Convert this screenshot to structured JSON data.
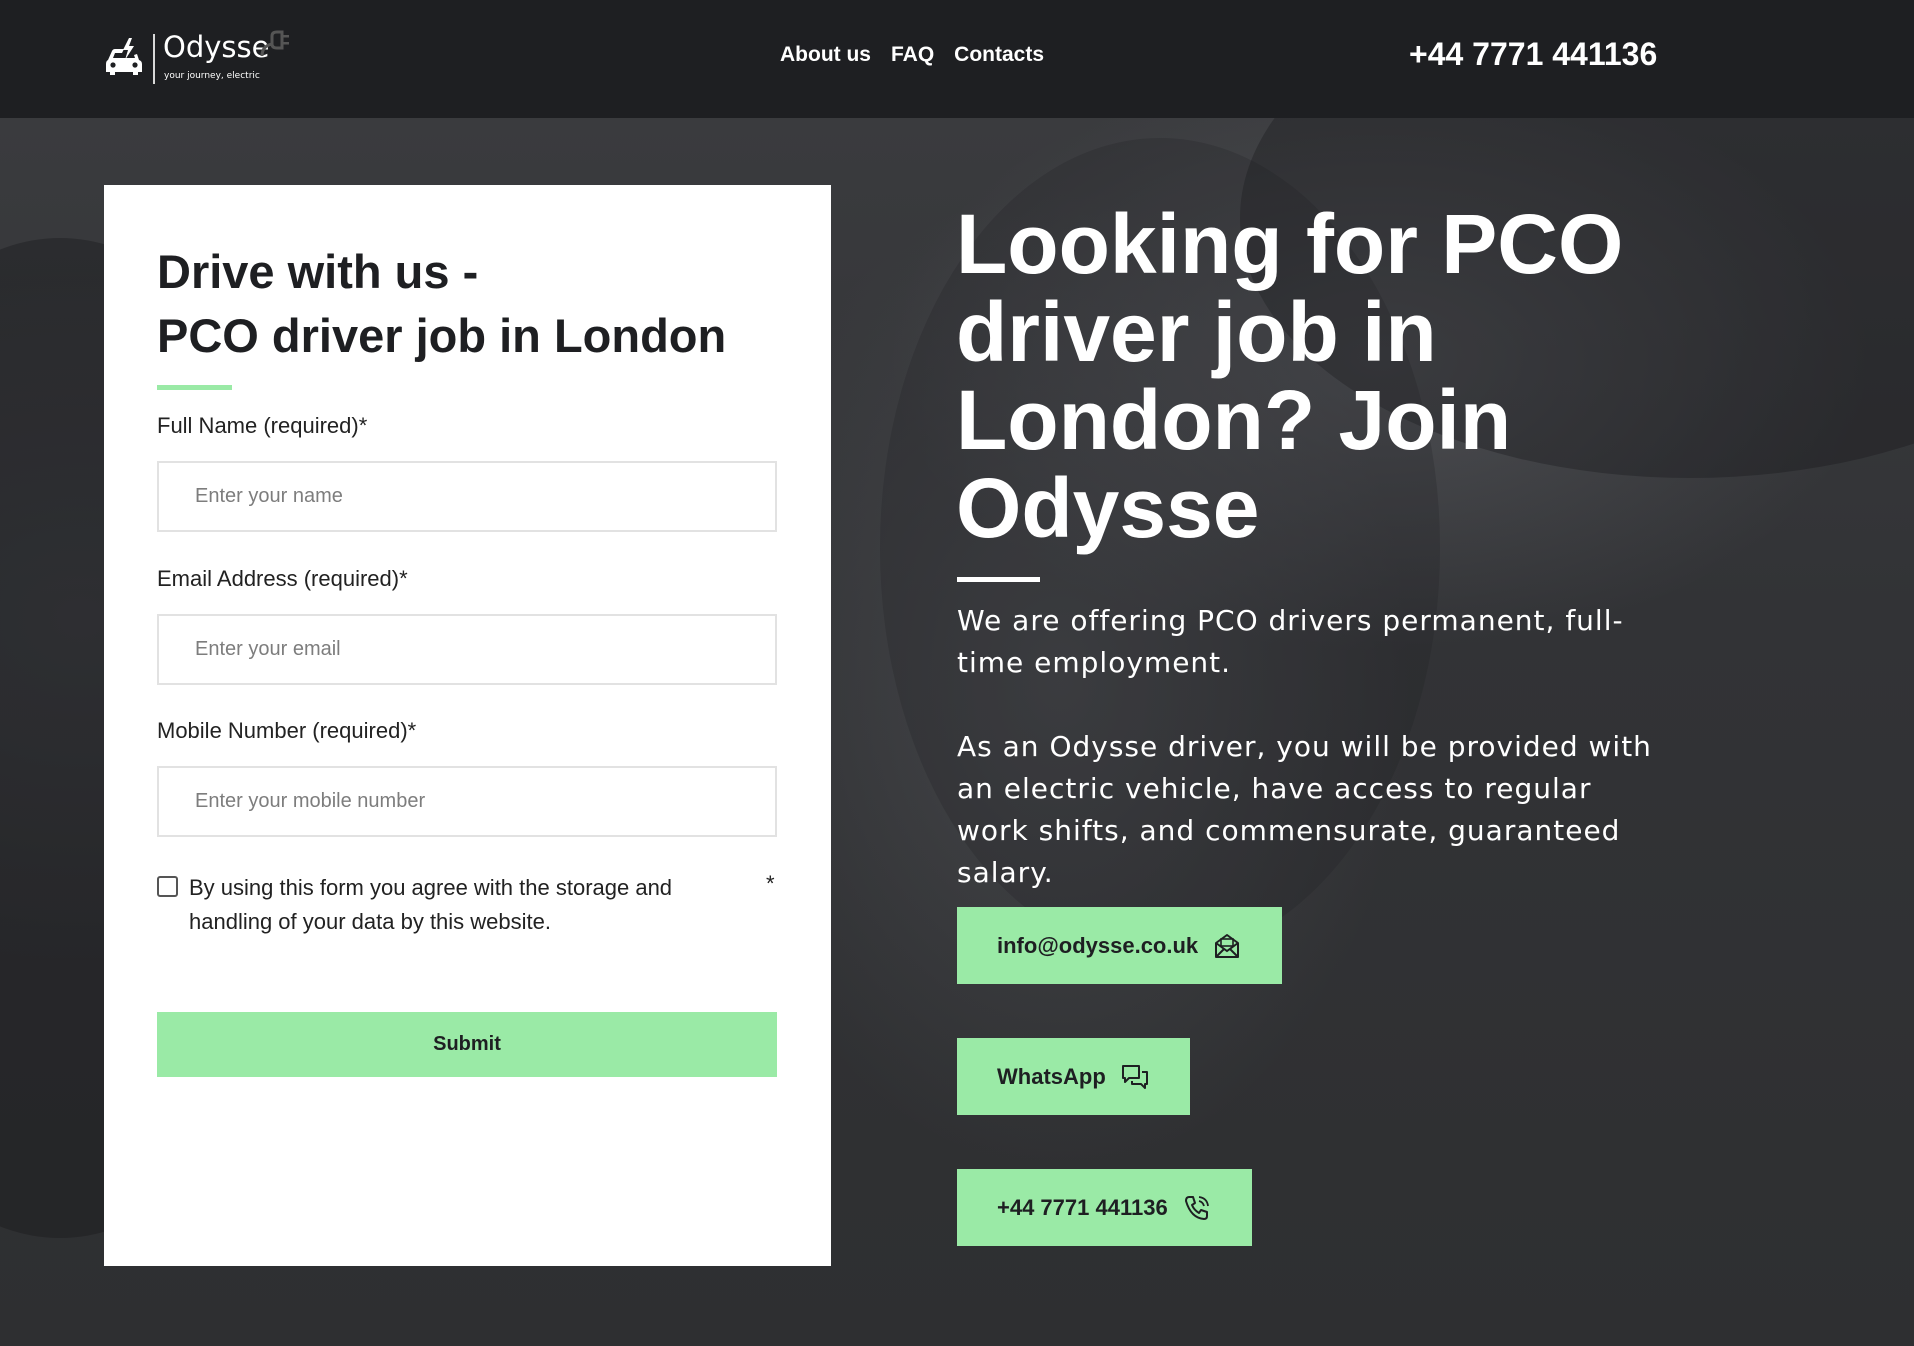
{
  "brand": {
    "name": "Odysse",
    "tagline": "your journey, electric"
  },
  "nav": {
    "items": [
      "About us",
      "FAQ",
      "Contacts"
    ]
  },
  "header": {
    "phone": "+44 7771 441136"
  },
  "form": {
    "title_line1": "Drive with us -",
    "title_line2": "PCO driver job in London",
    "fields": [
      {
        "label": "Full Name (required)*",
        "placeholder": "Enter your name",
        "value": ""
      },
      {
        "label": "Email Address (required)*",
        "placeholder": "Enter your email",
        "value": ""
      },
      {
        "label": "Mobile Number (required)*",
        "placeholder": "Enter your mobile number",
        "value": ""
      }
    ],
    "consent_text": "By using this form you agree with the storage and handling of your data by this website.",
    "consent_required_mark": "*",
    "consent_checked": false,
    "submit_label": "Submit"
  },
  "hero": {
    "title": "Looking for PCO driver job in London? Join Odysse",
    "paragraph1": "We are offering PCO drivers permanent, full-time employment.",
    "paragraph2": "As an Odysse driver, you will be provided with an electric vehicle, have access to regular work shifts, and commensurate, guaranteed salary."
  },
  "contacts": {
    "email": {
      "label": "info@odysse.co.uk",
      "icon": "envelope-icon"
    },
    "whatsapp": {
      "label": "WhatsApp",
      "icon": "chat-bubbles-icon"
    },
    "phone": {
      "label": "+44 7771 441136",
      "icon": "phone-icon"
    }
  },
  "colors": {
    "header_bg": "#1e1f22",
    "accent_green": "#9aeaa6",
    "text_dark": "#1e1f22",
    "card_bg": "#ffffff"
  }
}
